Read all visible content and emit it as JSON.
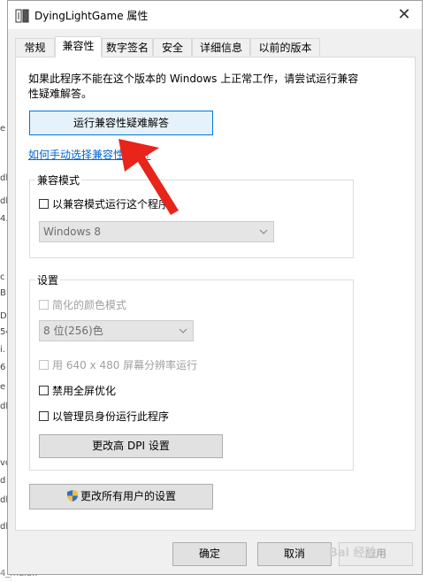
{
  "window": {
    "title": "DyingLightGame 属性"
  },
  "tabs": [
    "常规",
    "兼容性",
    "数字签名",
    "安全",
    "详细信息",
    "以前的版本"
  ],
  "compat": {
    "intro": "如果此程序不能在这个版本的 Windows 上正常工作，请尝试运行兼容性疑难解答。",
    "troubleshoot_btn": "运行兼容性疑难解答",
    "manual_link": "如何手动选择兼容性设置?",
    "mode_group": "兼容模式",
    "mode_checkbox": "以兼容模式运行这个程序",
    "os_select": "Windows 8",
    "settings_group": "设置",
    "reduced_color": "简化的颜色模式",
    "color_select": "8 位(256)色",
    "res_640": "用 640 x 480 屏幕分辨率运行",
    "disable_fullscreen": "禁用全屏优化",
    "run_as_admin": "以管理员身份运行此程序",
    "dpi_btn": "更改高 DPI 设置",
    "all_users_btn": "更改所有用户的设置"
  },
  "footer": {
    "ok": "确定",
    "cancel": "取消",
    "apply": "应用"
  },
  "background": {
    "left_glyphs": [
      "e",
      "dl",
      "dl",
      "4.",
      "c",
      "B",
      "D",
      "54",
      "i.",
      "6",
      "e",
      "dl",
      "vc",
      "d",
      "dl",
      "dl"
    ],
    "bottom_left": "4_mala.."
  },
  "watermark": "Bai 经验",
  "colors": {
    "accent": "#0078d7",
    "link": "#0066cc",
    "arrow": "#e8241b"
  }
}
